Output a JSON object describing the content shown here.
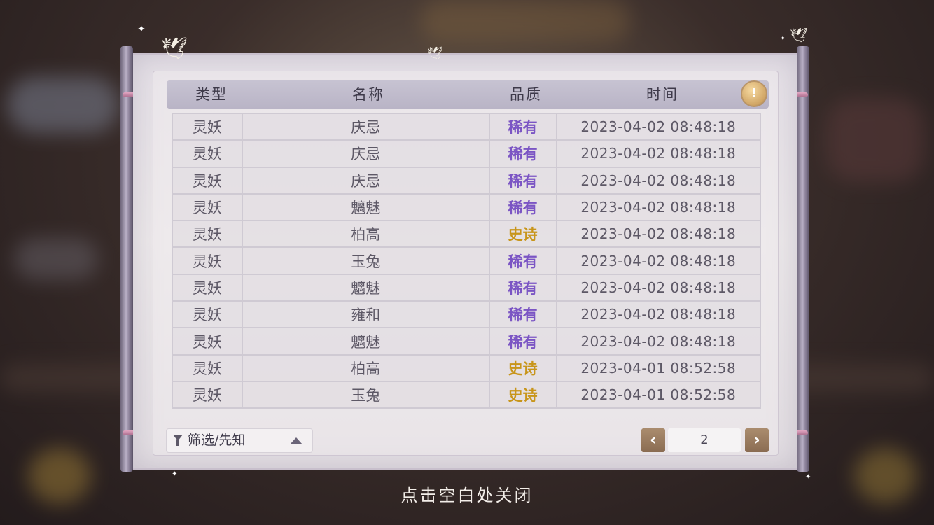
{
  "header": {
    "col_type": "类型",
    "col_name": "名称",
    "col_quality": "品质",
    "col_time": "时间",
    "info_icon": "!"
  },
  "records": [
    {
      "type": "灵妖",
      "name": "庆忌",
      "quality": "稀有",
      "quality_class": "rare",
      "time": "2023-04-02  08:48:18"
    },
    {
      "type": "灵妖",
      "name": "庆忌",
      "quality": "稀有",
      "quality_class": "rare",
      "time": "2023-04-02  08:48:18"
    },
    {
      "type": "灵妖",
      "name": "庆忌",
      "quality": "稀有",
      "quality_class": "rare",
      "time": "2023-04-02  08:48:18"
    },
    {
      "type": "灵妖",
      "name": "魑魅",
      "quality": "稀有",
      "quality_class": "rare",
      "time": "2023-04-02  08:48:18"
    },
    {
      "type": "灵妖",
      "name": "柏高",
      "quality": "史诗",
      "quality_class": "epic",
      "time": "2023-04-02  08:48:18"
    },
    {
      "type": "灵妖",
      "name": "玉兔",
      "quality": "稀有",
      "quality_class": "rare",
      "time": "2023-04-02  08:48:18"
    },
    {
      "type": "灵妖",
      "name": "魑魅",
      "quality": "稀有",
      "quality_class": "rare",
      "time": "2023-04-02  08:48:18"
    },
    {
      "type": "灵妖",
      "name": "雍和",
      "quality": "稀有",
      "quality_class": "rare",
      "time": "2023-04-02  08:48:18"
    },
    {
      "type": "灵妖",
      "name": "魑魅",
      "quality": "稀有",
      "quality_class": "rare",
      "time": "2023-04-02  08:48:18"
    },
    {
      "type": "灵妖",
      "name": "柏高",
      "quality": "史诗",
      "quality_class": "epic",
      "time": "2023-04-01  08:52:58"
    },
    {
      "type": "灵妖",
      "name": "玉兔",
      "quality": "史诗",
      "quality_class": "epic",
      "time": "2023-04-01  08:52:58"
    }
  ],
  "filter": {
    "label": "筛选/先知"
  },
  "pagination": {
    "prev": "‹",
    "current": "2",
    "next": "›"
  },
  "close_hint": "点击空白处关闭",
  "colors": {
    "rare": "#7b55c4",
    "epic": "#c8951a"
  }
}
